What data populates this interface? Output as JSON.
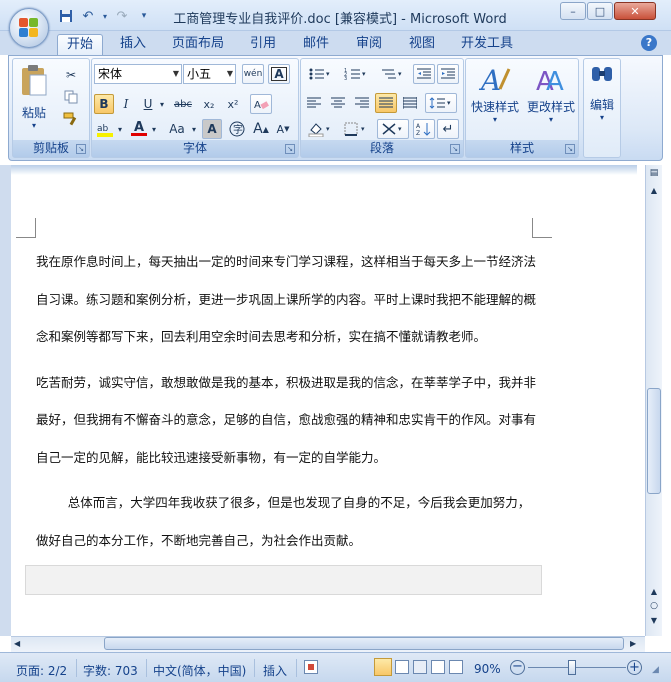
{
  "window": {
    "title": "工商管理专业自我评价.doc [兼容模式] - Microsoft Word",
    "minimize": "–",
    "maximize": "□",
    "close": "✕"
  },
  "qat": {
    "save_icon": "save-icon",
    "undo_icon": "undo-icon",
    "redo_icon": "redo-icon",
    "customize_icon": "customize-icon"
  },
  "tabs": [
    "开始",
    "插入",
    "页面布局",
    "引用",
    "邮件",
    "审阅",
    "视图",
    "开发工具"
  ],
  "help_label": "?",
  "ribbon": {
    "clipboard": {
      "paste": "粘贴",
      "label": "剪贴板"
    },
    "font": {
      "font_name": "宋体",
      "font_size": "小五",
      "wen": "wén",
      "bold": "B",
      "italic": "I",
      "underline": "U",
      "strike": "abc",
      "sub": "x₂",
      "sup": "x²",
      "grow": "A",
      "shrink": "A",
      "aa": "Aa",
      "char_border": "A",
      "font_color": "A",
      "label": "字体"
    },
    "paragraph": {
      "label": "段落"
    },
    "styles": {
      "quick": "快速样式",
      "change": "更改样式",
      "label": "样式"
    },
    "editing": {
      "edit": "编辑"
    }
  },
  "document": {
    "paragraphs": [
      [
        "我在原作息时间上，每天抽出一定的时间来专门学习课程，这样相当于每天多上一节经济法",
        "自习课。练习题和案例分析，更进一步巩固上课所学的内容。平时上课时我把不能理解的概",
        "念和案例等都写下来，回去利用空余时间去思考和分析，实在搞不懂就请教老师。"
      ],
      [
        "吃苦耐劳，诚实守信，敢想敢做是我的基本，积极进取是我的信念，在莘莘学子中，我并非",
        "最好，但我拥有不懈奋斗的意念，足够的自信，愈战愈强的精神和忠实肯干的作风。对事有",
        "自己一定的见解，能比较迅速接受新事物，有一定的自学能力。"
      ],
      [
        "        总体而言，大学四年我收获了很多，但是也发现了自身的不足，今后我会更加努力，",
        "做好自己的本分工作，不断地完善自己，为社会作出贡献。"
      ]
    ]
  },
  "status": {
    "page": "页面: 2/2",
    "words": "字数: 703",
    "lang": "中文(简体，中国)",
    "mode": "插入",
    "zoom": "90%",
    "zoom_fraction": 0.9
  }
}
